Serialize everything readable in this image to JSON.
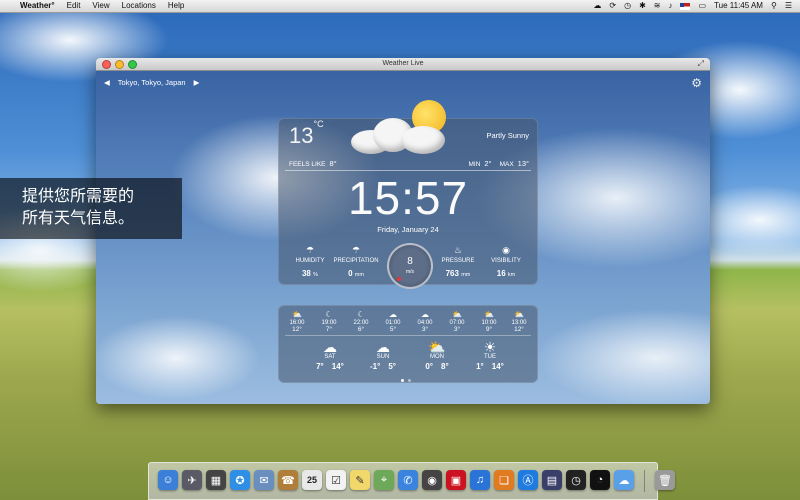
{
  "menubar": {
    "apple": "",
    "app_name": "Weather°",
    "menus": [
      "Edit",
      "View",
      "Locations",
      "Help"
    ],
    "status": {
      "clock": "Tue 11:45 AM"
    }
  },
  "window": {
    "title": "Weather Live",
    "location": "Tokyo, Tokyo, Japan"
  },
  "current": {
    "temp": "13",
    "unit": "°C",
    "condition": "Partly Sunny",
    "feels_like_label": "FEELS LIKE",
    "feels_like": "8°",
    "min_label": "MIN",
    "min": "2°",
    "max_label": "MAX",
    "max": "13°",
    "time": "15:57",
    "date": "Friday, January 24"
  },
  "stats": {
    "humidity": {
      "label": "HUMIDITY",
      "value": "38",
      "unit": "%"
    },
    "precipitation": {
      "label": "PRECIPITATION",
      "value": "0",
      "unit": "mm"
    },
    "wind": {
      "value": "8",
      "unit": "m/s"
    },
    "pressure": {
      "label": "PRESSURE",
      "value": "763",
      "unit": "mm"
    },
    "visibility": {
      "label": "VISIBILITY",
      "value": "16",
      "unit": "km"
    }
  },
  "hourly": [
    {
      "time": "16:00",
      "temp": "12°",
      "icon": "sun-cloud-icon"
    },
    {
      "time": "19:00",
      "temp": "7°",
      "icon": "moon-icon"
    },
    {
      "time": "22:00",
      "temp": "6°",
      "icon": "moon-icon"
    },
    {
      "time": "01:00",
      "temp": "5°",
      "icon": "moon-cloud-icon"
    },
    {
      "time": "04:00",
      "temp": "3°",
      "icon": "moon-cloud-icon"
    },
    {
      "time": "07:00",
      "temp": "3°",
      "icon": "sun-cloud-icon"
    },
    {
      "time": "10:00",
      "temp": "9°",
      "icon": "sun-cloud-icon"
    },
    {
      "time": "13:00",
      "temp": "12°",
      "icon": "sun-cloud-icon"
    }
  ],
  "daily": [
    {
      "day": "SAT",
      "low": "7°",
      "high": "14°",
      "icon": "cloud-icon"
    },
    {
      "day": "SUN",
      "low": "-1°",
      "high": "5°",
      "icon": "cloud-icon"
    },
    {
      "day": "MON",
      "low": "0°",
      "high": "8°",
      "icon": "sun-cloud-icon"
    },
    {
      "day": "TUE",
      "low": "1°",
      "high": "14°",
      "icon": "sun-icon"
    }
  ],
  "overlay": {
    "line1": "提供您所需要的",
    "line2": "所有天气信息。"
  },
  "dock": [
    {
      "icon": "finder-icon",
      "color": "#3b7fd8"
    },
    {
      "icon": "launchpad-icon",
      "color": "#5a5a66"
    },
    {
      "icon": "mission-control-icon",
      "color": "#444"
    },
    {
      "icon": "safari-icon",
      "color": "#2f8ee6"
    },
    {
      "icon": "mail-icon",
      "color": "#6a8fbf"
    },
    {
      "icon": "contacts-icon",
      "color": "#b07d3a"
    },
    {
      "icon": "calendar-icon",
      "color": "#e8e8e8",
      "label": "25"
    },
    {
      "icon": "reminders-icon",
      "color": "#f2f2f2"
    },
    {
      "icon": "notes-icon",
      "color": "#f2d86a"
    },
    {
      "icon": "maps-icon",
      "color": "#6ea95a"
    },
    {
      "icon": "messages-icon",
      "color": "#3a84e0"
    },
    {
      "icon": "facetime-icon",
      "color": "#444"
    },
    {
      "icon": "photo-booth-icon",
      "color": "#c12"
    },
    {
      "icon": "itunes-icon",
      "color": "#2a74d8"
    },
    {
      "icon": "ibooks-icon",
      "color": "#e07b22"
    },
    {
      "icon": "app-store-icon",
      "color": "#1f7be0"
    },
    {
      "icon": "preview-icon",
      "color": "#3a3f6a"
    },
    {
      "icon": "dashboard-icon",
      "color": "#222"
    },
    {
      "icon": "clock-app-icon",
      "color": "#111"
    },
    {
      "icon": "weather-app-icon",
      "color": "#5aa0e8"
    },
    {
      "icon": "trash-icon",
      "color": "#9a9a9a"
    }
  ]
}
